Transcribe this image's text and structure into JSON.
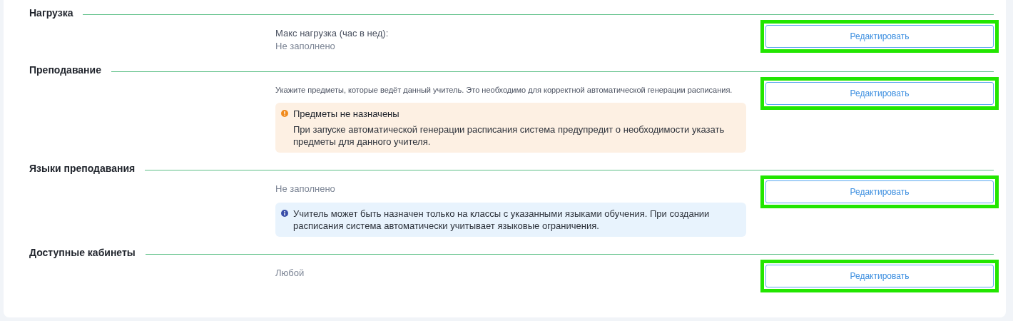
{
  "sections": [
    {
      "title": "Нагрузка",
      "items": [
        {
          "kind": "field",
          "label": "Макс нагрузка (час в нед):",
          "value": "Не заполнено"
        }
      ],
      "button": {
        "label": "Редактировать",
        "highlighted": true
      }
    },
    {
      "title": "Преподавание",
      "items": [
        {
          "kind": "hint",
          "text": "Укажите предметы, которые ведёт данный учитель. Это необходимо для корректной автоматической генерации расписания."
        },
        {
          "kind": "warning",
          "title": "Предметы не назначены",
          "text": "При запуске автоматической генерации расписания система предупредит о необходимости указать предметы для данного учителя."
        }
      ],
      "button": {
        "label": "Редактировать",
        "highlighted": true
      }
    },
    {
      "title": "Языки преподавания",
      "items": [
        {
          "kind": "value",
          "value": "Не заполнено"
        },
        {
          "kind": "info",
          "text": "Учитель может быть назначен только на классы с указанными языками обучения. При создании расписания система автоматически учитывает языковые ограничения."
        }
      ],
      "button": {
        "label": "Редактировать",
        "highlighted": true
      }
    },
    {
      "title": "Доступные кабинеты",
      "items": [
        {
          "kind": "value",
          "value": "Любой"
        }
      ],
      "button": {
        "label": "Редактировать",
        "highlighted": true
      }
    }
  ]
}
